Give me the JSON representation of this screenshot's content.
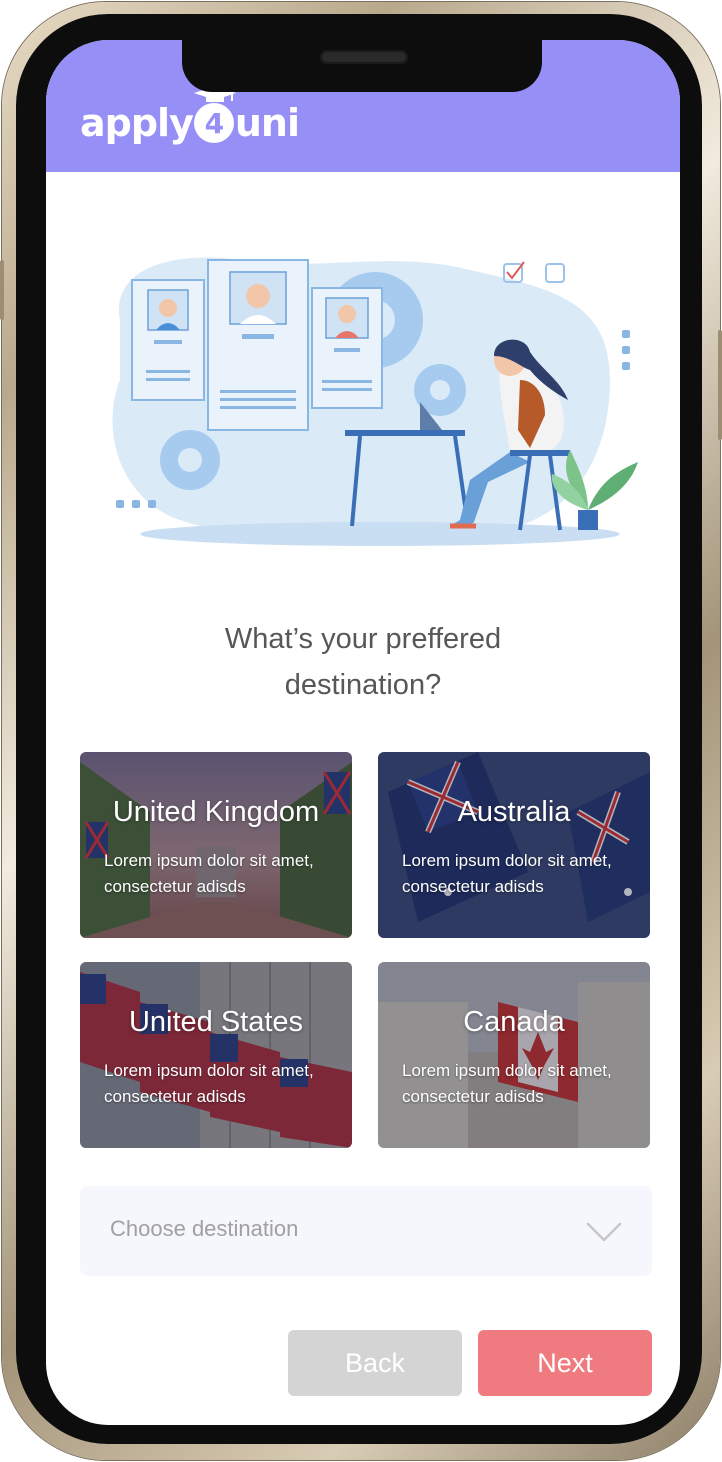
{
  "app": {
    "logo_text_left": "apply",
    "logo_digit": "4",
    "logo_text_right": "uni",
    "brand_color": "#958ff6"
  },
  "question": {
    "line1": "What’s your preffered",
    "line2": "destination?"
  },
  "destinations": [
    {
      "name": "United Kingdom",
      "description": "Lorem ipsum dolor sit amet, consectetur adisds"
    },
    {
      "name": "Australia",
      "description": "Lorem ipsum dolor sit amet, consectetur adisds"
    },
    {
      "name": "United States",
      "description": "Lorem ipsum dolor sit amet, consectetur adisds"
    },
    {
      "name": "Canada",
      "description": "Lorem ipsum dolor sit amet, consectetur adisds"
    }
  ],
  "destination_select": {
    "placeholder": "Choose destination"
  },
  "buttons": {
    "back": "Back",
    "next": "Next"
  },
  "colors": {
    "back_button": "#d4d4d4",
    "next_button": "#ef7b80",
    "select_background": "#f6f7fc"
  },
  "icons": {
    "logo_cap": "graduation-cap-icon",
    "dropdown": "chevron-down-icon"
  }
}
